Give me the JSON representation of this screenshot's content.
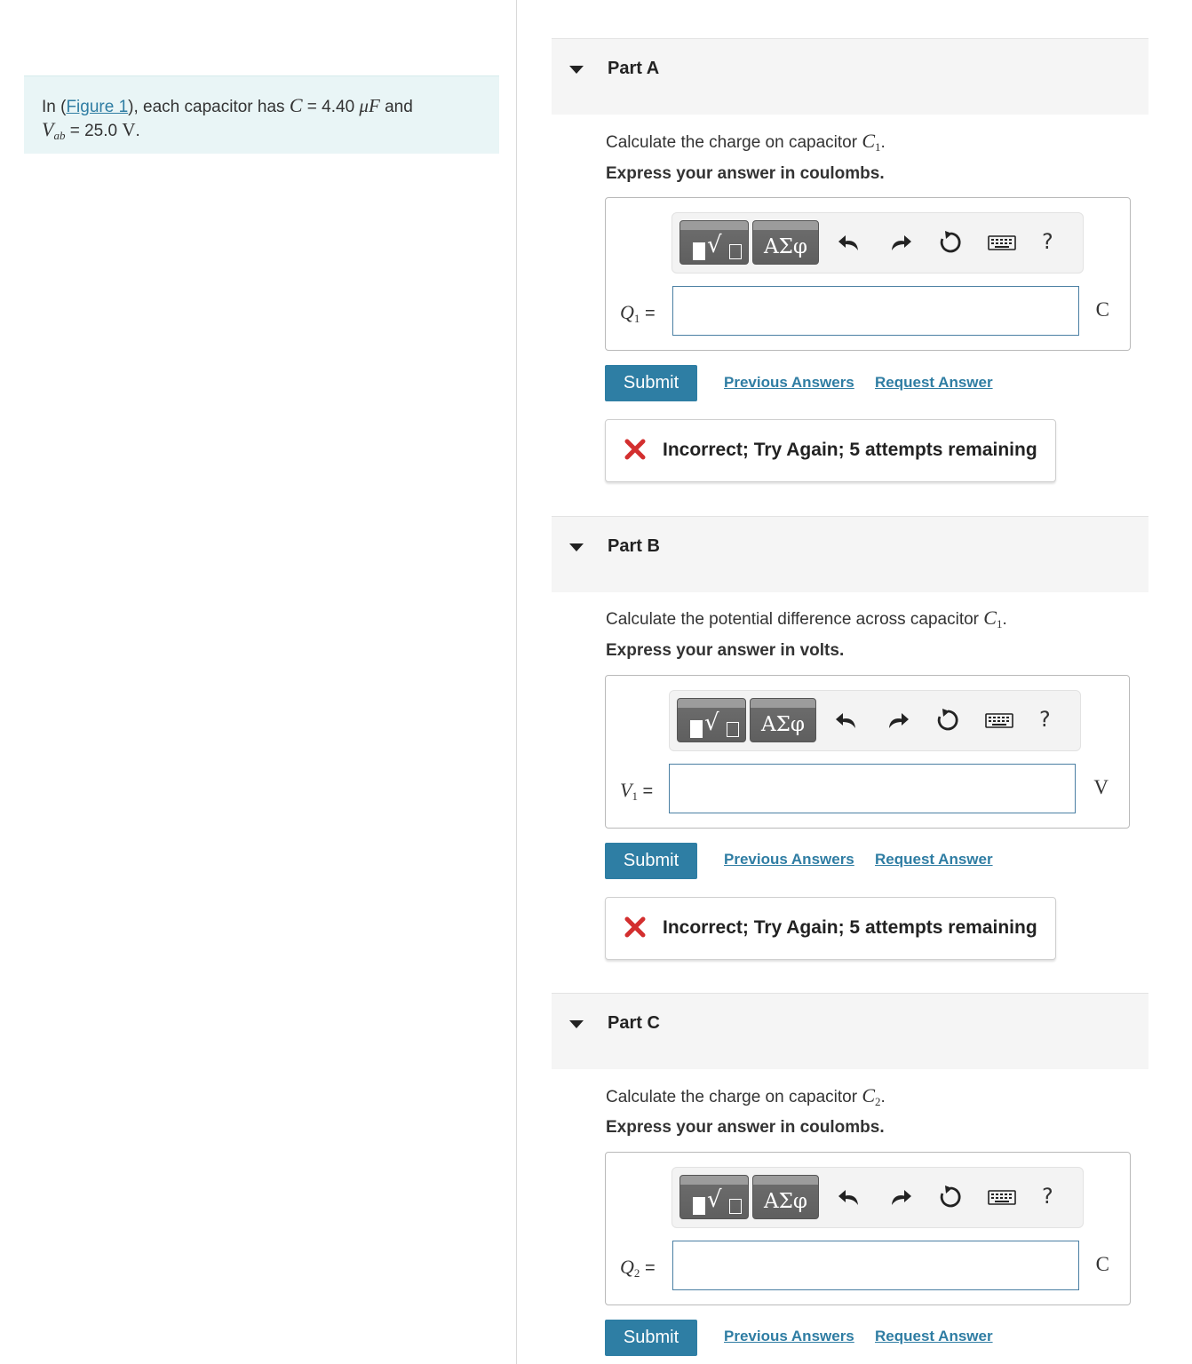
{
  "intro": {
    "prefix": "In (",
    "figure_link": "Figure 1",
    "mid": "), each capacitor has ",
    "C_sym": "C",
    "eq1": " = 4.40 ",
    "C_unit": "μF",
    "and": " and",
    "V_sym": "V",
    "V_sub": "ab",
    "eq2": " = 25.0 ",
    "V_unit": "V",
    "end": "."
  },
  "parts": [
    {
      "title": "Part A",
      "question_text": "Calculate the charge on capacitor ",
      "question_sym": "C",
      "question_sub": "1",
      "question_end": ".",
      "instruction": "Express your answer in coulombs.",
      "toolbar": {
        "greek_label": "ΑΣφ",
        "help_label": "?"
      },
      "var_sym": "Q",
      "var_sub": "1",
      "var_eq": " =",
      "input_value": "",
      "unit": "C",
      "submit_label": "Submit",
      "prev_label": "Previous Answers",
      "request_label": "Request Answer",
      "feedback": "Incorrect; Try Again; 5 attempts remaining"
    },
    {
      "title": "Part B",
      "question_text": "Calculate the potential difference across capacitor ",
      "question_sym": "C",
      "question_sub": "1",
      "question_end": ".",
      "instruction": "Express your answer in volts.",
      "toolbar": {
        "greek_label": "ΑΣφ",
        "help_label": "?"
      },
      "var_sym": "V",
      "var_sub": "1",
      "var_eq": " =",
      "input_value": "",
      "unit": "V",
      "submit_label": "Submit",
      "prev_label": "Previous Answers",
      "request_label": "Request Answer",
      "feedback": "Incorrect; Try Again; 5 attempts remaining"
    },
    {
      "title": "Part C",
      "question_text": "Calculate the charge on capacitor ",
      "question_sym": "C",
      "question_sub": "2",
      "question_end": ".",
      "instruction": "Express your answer in coulombs.",
      "toolbar": {
        "greek_label": "ΑΣφ",
        "help_label": "?"
      },
      "var_sym": "Q",
      "var_sub": "2",
      "var_eq": " =",
      "input_value": "",
      "unit": "C",
      "submit_label": "Submit",
      "prev_label": "Previous Answers",
      "request_label": "Request Answer"
    }
  ],
  "colors": {
    "accent": "#2e7ea4",
    "link": "#2f7da3",
    "error": "#d32f2f",
    "intro_bg": "#e9f5f6"
  }
}
